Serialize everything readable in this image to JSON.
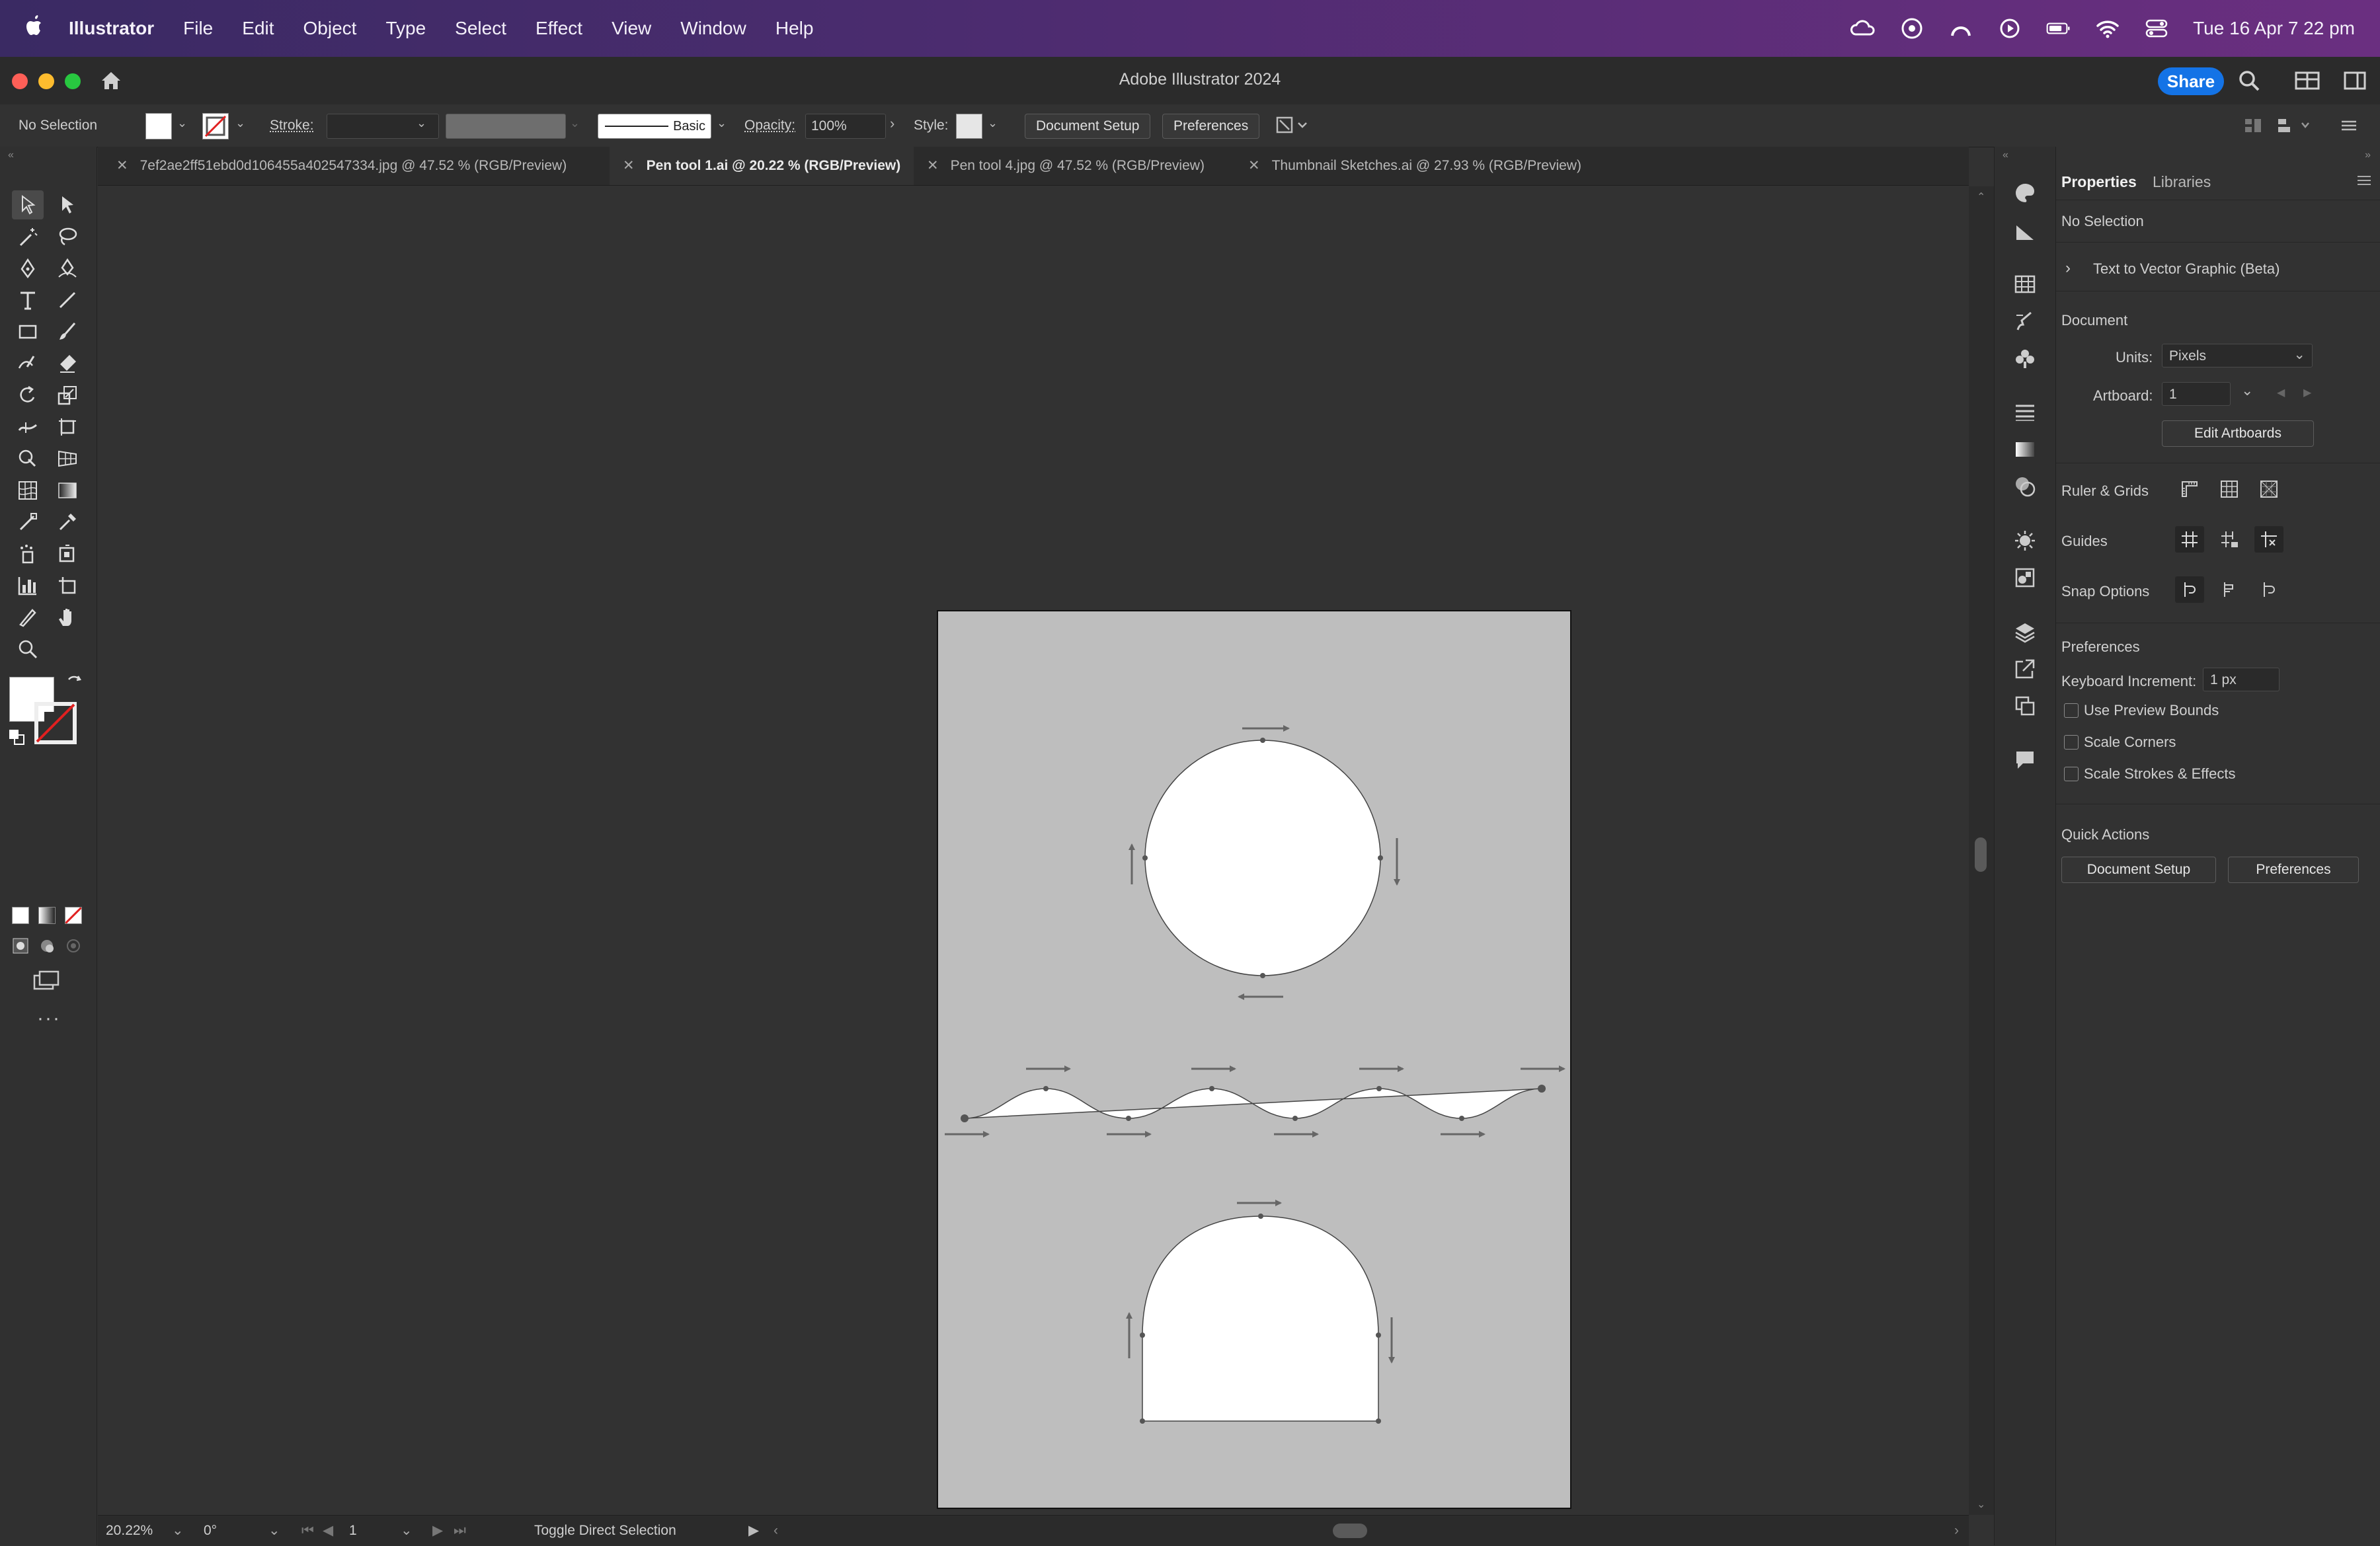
{
  "menubar": {
    "app_name": "Illustrator",
    "items": [
      "File",
      "Edit",
      "Object",
      "Type",
      "Select",
      "Effect",
      "View",
      "Window",
      "Help"
    ],
    "datetime": "Tue 16 Apr  7 22 pm",
    "status_icons": [
      "creative-cloud-icon",
      "screen-icon",
      "arc-icon",
      "play-icon",
      "battery-icon",
      "wifi-icon",
      "control-center-icon"
    ]
  },
  "window": {
    "title": "Adobe Illustrator 2024",
    "share_label": "Share"
  },
  "control_bar": {
    "selection_label": "No Selection",
    "stroke_label": "Stroke:",
    "brush_label": "Basic",
    "opacity_label": "Opacity:",
    "opacity_value": "100%",
    "style_label": "Style:",
    "document_setup_label": "Document Setup",
    "preferences_label": "Preferences"
  },
  "tabs": [
    {
      "label": "7ef2ae2ff51ebd0d106455a402547334.jpg @ 47.52 % (RGB/Preview)",
      "active": false
    },
    {
      "label": "Pen tool 1.ai @ 20.22 % (RGB/Preview)",
      "active": true
    },
    {
      "label": "Pen tool 4.jpg @ 47.52 % (RGB/Preview)",
      "active": false
    },
    {
      "label": "Thumbnail Sketches.ai @ 27.93 % (RGB/Preview)",
      "active": false
    }
  ],
  "panel": {
    "tabs": [
      "Properties",
      "Libraries"
    ],
    "selection": "No Selection",
    "text_to_vector": "Text to Vector Graphic (Beta)",
    "document_heading": "Document",
    "units_label": "Units:",
    "units_value": "Pixels",
    "artboard_label": "Artboard:",
    "artboard_value": "1",
    "edit_artboards_label": "Edit Artboards",
    "ruler_grids_label": "Ruler & Grids",
    "guides_label": "Guides",
    "snap_options_label": "Snap Options",
    "preferences_heading": "Preferences",
    "keyboard_increment_label": "Keyboard Increment:",
    "keyboard_increment_value": "1 px",
    "checkboxes": [
      {
        "label": "Use Preview Bounds",
        "checked": false
      },
      {
        "label": "Scale Corners",
        "checked": false
      },
      {
        "label": "Scale Strokes & Effects",
        "checked": false
      }
    ],
    "quick_actions_heading": "Quick Actions",
    "qa_document_setup": "Document Setup",
    "qa_preferences": "Preferences"
  },
  "status_bar": {
    "zoom": "20.22%",
    "rotation": "0°",
    "artboard": "1",
    "tool_hint": "Toggle Direct Selection"
  },
  "colors": {
    "accent": "#1473e6",
    "artboard": "#bebebe",
    "shape_fill": "#ffffff",
    "none_slash": "#e02020"
  }
}
